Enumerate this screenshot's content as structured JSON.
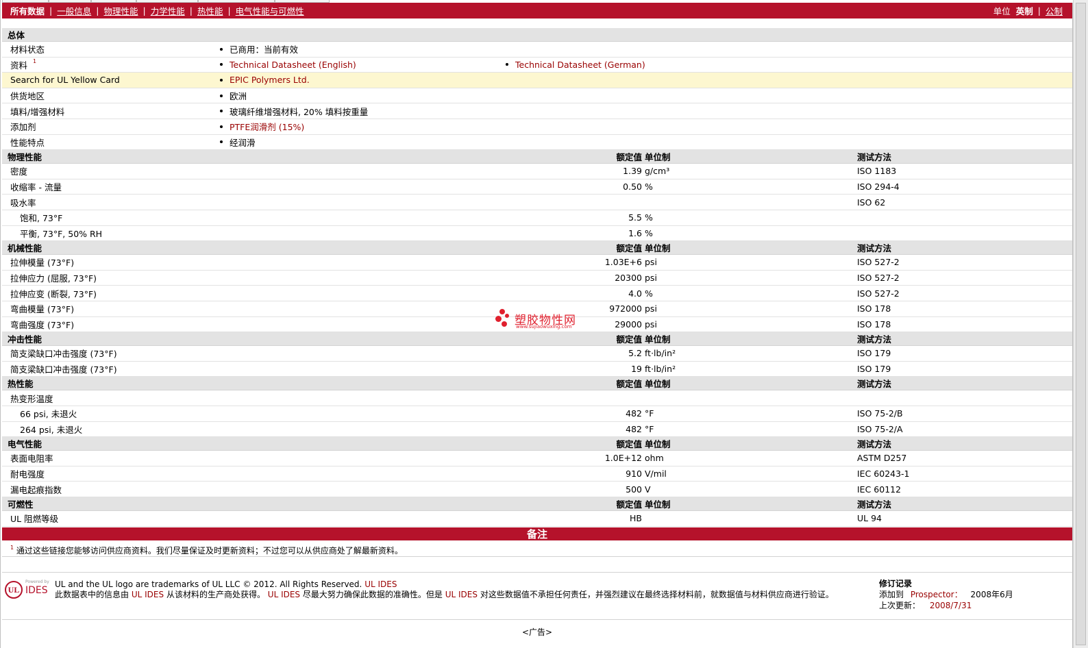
{
  "nav": {
    "all": "所有数据",
    "links": [
      "一般信息",
      "物理性能",
      "力学性能",
      "热性能",
      "电气性能与可燃性"
    ],
    "units_label": "单位",
    "units_current": "英制",
    "units_other": "公制"
  },
  "general": {
    "title": "总体",
    "rows": [
      {
        "label": "材料状态",
        "values": [
          "已商用：当前有效"
        ]
      },
      {
        "label": "资料",
        "sup": "1",
        "values": [
          "Technical Datasheet (English)",
          "Technical Datasheet (German)"
        ]
      },
      {
        "label": "Search for UL Yellow Card",
        "values": [
          "EPIC Polymers Ltd."
        ]
      },
      {
        "label": "供货地区",
        "values": [
          "欧洲"
        ]
      },
      {
        "label": "填料/增强材料",
        "values": [
          "玻璃纤维增强材料, 20% 填料按重量"
        ]
      },
      {
        "label": "添加剂",
        "values": [
          "PTFE润滑剂 (15%)"
        ]
      },
      {
        "label": "性能特点",
        "values": [
          "经润滑"
        ]
      }
    ]
  },
  "col_headers": {
    "value": "额定值",
    "unit": "单位制",
    "test": "测试方法"
  },
  "sections": [
    {
      "title": "物理性能",
      "rows": [
        {
          "label": "密度",
          "value": "1.39",
          "unit": "g/cm³",
          "test": "ISO 1183"
        },
        {
          "label": "收缩率 - 流量",
          "value": "0.50",
          "unit": "%",
          "test": "ISO 294-4"
        },
        {
          "label": "吸水率",
          "value": "",
          "unit": "",
          "test": "ISO 62"
        },
        {
          "label": "饱和, 73°F",
          "value": "5.5",
          "unit": "%",
          "test": "",
          "sub": true
        },
        {
          "label": "平衡, 73°F, 50% RH",
          "value": "1.6",
          "unit": "%",
          "test": "",
          "sub": true
        }
      ]
    },
    {
      "title": "机械性能",
      "rows": [
        {
          "label": "拉伸模量 (73°F)",
          "value": "1.03E+6",
          "unit": "psi",
          "test": "ISO 527-2"
        },
        {
          "label": "拉伸应力 (屈服, 73°F)",
          "value": "20300",
          "unit": "psi",
          "test": "ISO 527-2"
        },
        {
          "label": "拉伸应变 (断裂, 73°F)",
          "value": "4.0",
          "unit": "%",
          "test": "ISO 527-2"
        },
        {
          "label": "弯曲模量 (73°F)",
          "value": "972000",
          "unit": "psi",
          "test": "ISO 178"
        },
        {
          "label": "弯曲强度 (73°F)",
          "value": "29000",
          "unit": "psi",
          "test": "ISO 178"
        }
      ]
    },
    {
      "title": "冲击性能",
      "rows": [
        {
          "label": "简支梁缺口冲击强度 (73°F)",
          "value": "5.2",
          "unit": "ft·lb/in²",
          "test": "ISO 179"
        },
        {
          "label": "简支梁缺口冲击强度 (73°F)",
          "value": "19",
          "unit": "ft·lb/in²",
          "test": "ISO 179"
        }
      ]
    },
    {
      "title": "热性能",
      "rows": [
        {
          "label": "热变形温度",
          "value": "",
          "unit": "",
          "test": ""
        },
        {
          "label": "66 psi, 未退火",
          "value": "482",
          "unit": "°F",
          "test": "ISO 75-2/B",
          "sub": true
        },
        {
          "label": "264 psi, 未退火",
          "value": "482",
          "unit": "°F",
          "test": "ISO 75-2/A",
          "sub": true
        }
      ]
    },
    {
      "title": "电气性能",
      "rows": [
        {
          "label": "表面电阻率",
          "value": "1.0E+12",
          "unit": "ohm",
          "test": "ASTM D257"
        },
        {
          "label": "耐电强度",
          "value": "910",
          "unit": "V/mil",
          "test": "IEC 60243-1"
        },
        {
          "label": "漏电起痕指数",
          "value": "500",
          "unit": "V",
          "test": "IEC 60112"
        }
      ]
    },
    {
      "title": "可燃性",
      "rows": [
        {
          "label": "UL 阻燃等级",
          "value": "HB",
          "unit": "",
          "test": "UL 94",
          "link": true
        }
      ]
    }
  ],
  "notes": {
    "title": "备注",
    "sup": "1",
    "text": "通过这些链接您能够访问供应商资料。我们尽量保证及时更新资料；不过您可以从供应商处了解最新资料。"
  },
  "footer": {
    "logo_powered": "Powered by",
    "logo_ul": "UL",
    "logo_ides": "IDES",
    "trademark_a": "UL and the UL logo are trademarks of UL LLC © 2012. All Rights Reserved.",
    "trademark_b": "UL IDES",
    "disclaimer_1": "此数据表中的信息由",
    "disclaimer_2": "UL IDES",
    "disclaimer_3": "从该材料的生产商处获得。",
    "disclaimer_4": "UL IDES",
    "disclaimer_5": "尽最大努力确保此数据的准确性。但是",
    "disclaimer_6": "UL IDES",
    "disclaimer_7": "对这些数据值不承担任何责任，并强烈建议在最终选择材料前，就数据值与材料供应商进行验证。",
    "rev_title": "修订记录",
    "rev_added_label": "添加到",
    "rev_added_link": "Prospector：",
    "rev_added_date": "2008年6月",
    "rev_updated_label": "上次更新：",
    "rev_updated_date": "2008/7/31",
    "ad": "<广告>"
  },
  "watermark": {
    "text": "塑胶物性网",
    "url": "www.sujiaowuxing.com"
  },
  "colors": {
    "brand": "#b5122b",
    "link": "#990000",
    "section_bg": "#e3e3e3",
    "highlight_bg": "#fdf7d0"
  }
}
